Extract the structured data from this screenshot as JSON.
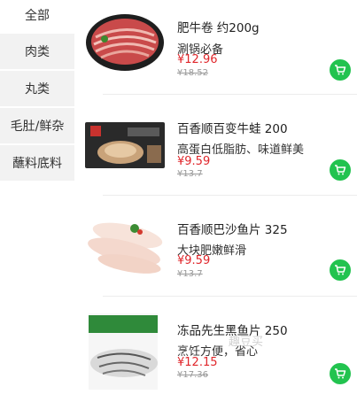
{
  "sidebar": {
    "items": [
      {
        "label": "全部"
      },
      {
        "label": "肉类"
      },
      {
        "label": "丸类"
      },
      {
        "label": "毛肚/鲜杂"
      },
      {
        "label": "蘸料底料"
      }
    ]
  },
  "products": [
    {
      "name": "肥牛卷 约200g",
      "desc": "涮锅必备",
      "price": "¥12.96",
      "original_price": "¥18.52",
      "image": "beef-rolls"
    },
    {
      "name": "百香顺百变牛蛙 200",
      "desc": "高蛋白低脂肪、味道鲜美",
      "price": "¥9.59",
      "original_price": "¥13.7",
      "image": "frog-package"
    },
    {
      "name": "百香顺巴沙鱼片 325",
      "desc": "大块肥嫩鲜滑",
      "price": "¥9.59",
      "original_price": "¥13.7",
      "image": "basa-fish"
    },
    {
      "name": "冻品先生黑鱼片 250",
      "desc": "烹饪方便，省心",
      "price": "¥12.15",
      "original_price": "¥17.36",
      "image": "snakehead-fish"
    }
  ],
  "watermark": "趣豆买",
  "colors": {
    "accent_green": "#22c34f",
    "price_red": "#e0262b",
    "sidebar_bg": "#f2f2f2"
  }
}
